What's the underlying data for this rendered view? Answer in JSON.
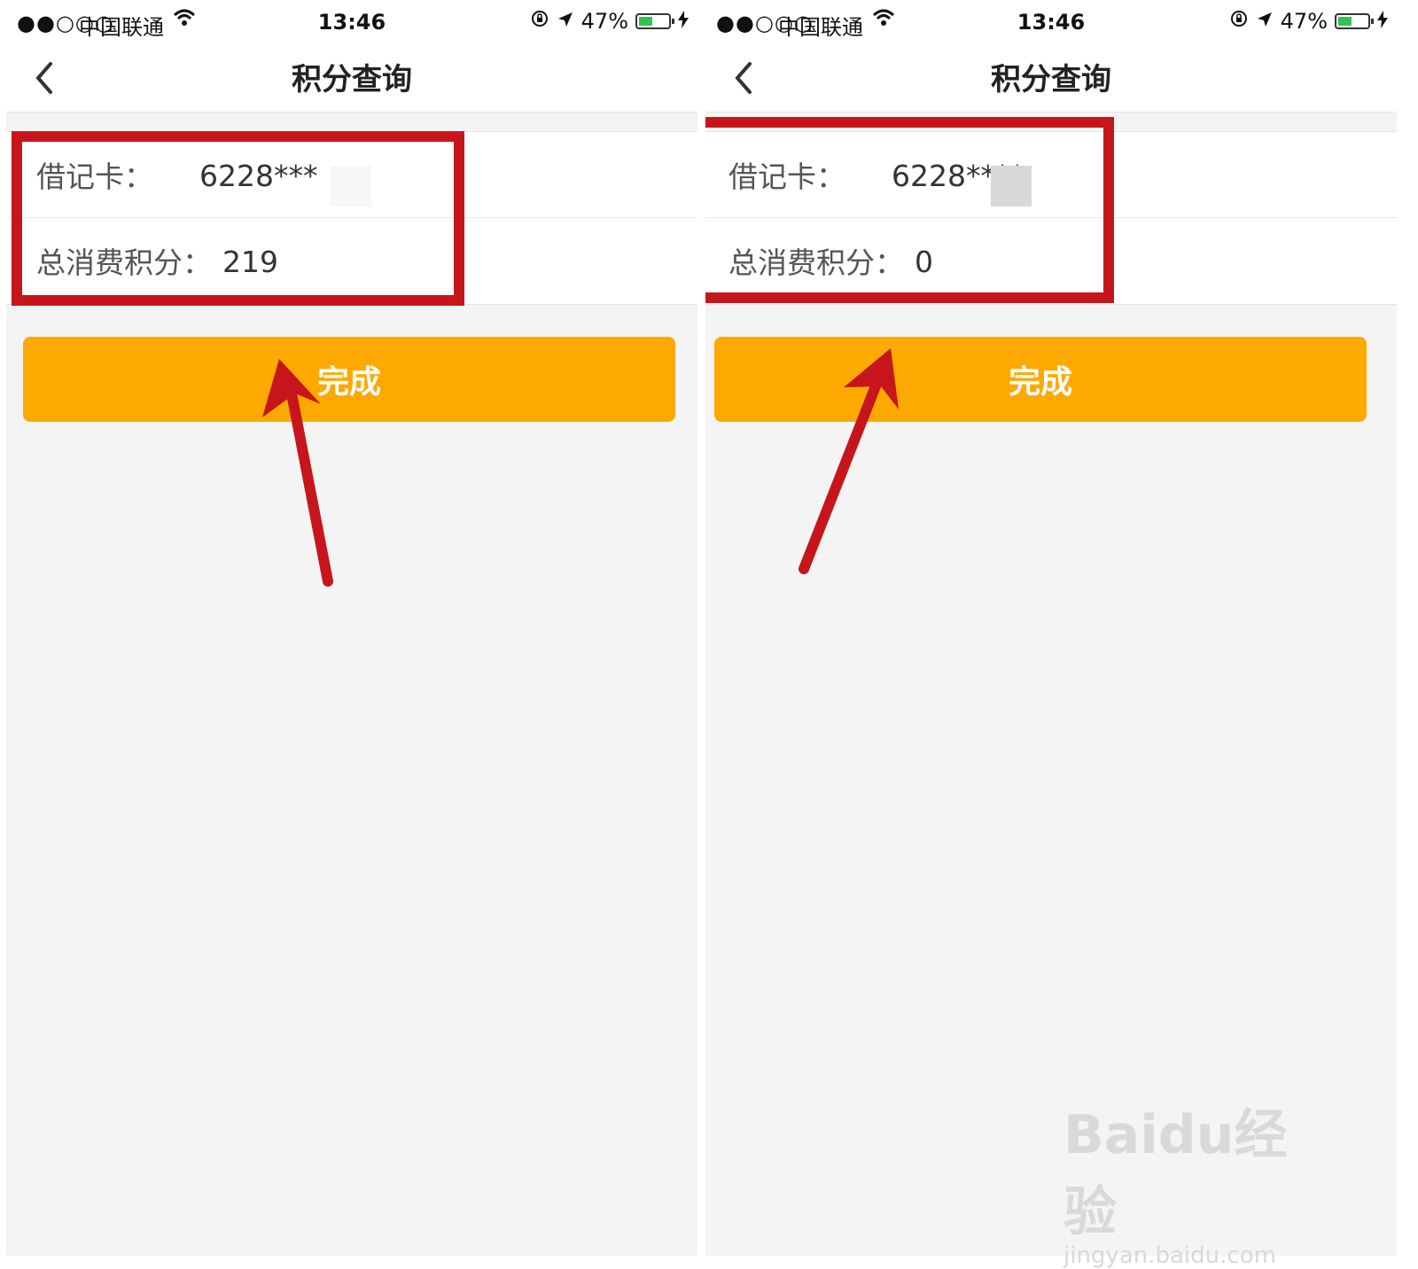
{
  "status_bar": {
    "signal": "●●○○○",
    "carrier": "中国联通",
    "time": "13:46",
    "battery_percent": "47%",
    "battery_level": 0.47
  },
  "screens": [
    {
      "nav_title": "积分查询",
      "card_label": "借记卡：",
      "card_number": "6228***",
      "points_label": "总消费积分：",
      "points_value": "219",
      "button_label": "完成"
    },
    {
      "nav_title": "积分查询",
      "card_label": "借记卡：",
      "card_number": "6228****",
      "points_label": "总消费积分：",
      "points_value": "0",
      "button_label": "完成"
    }
  ],
  "watermark": {
    "brand": "Baidu经验",
    "url": "jingyan.baidu.com"
  },
  "colors": {
    "button": "#fea900",
    "annotation_red": "#c6161b",
    "battery_green": "#33c24d"
  }
}
